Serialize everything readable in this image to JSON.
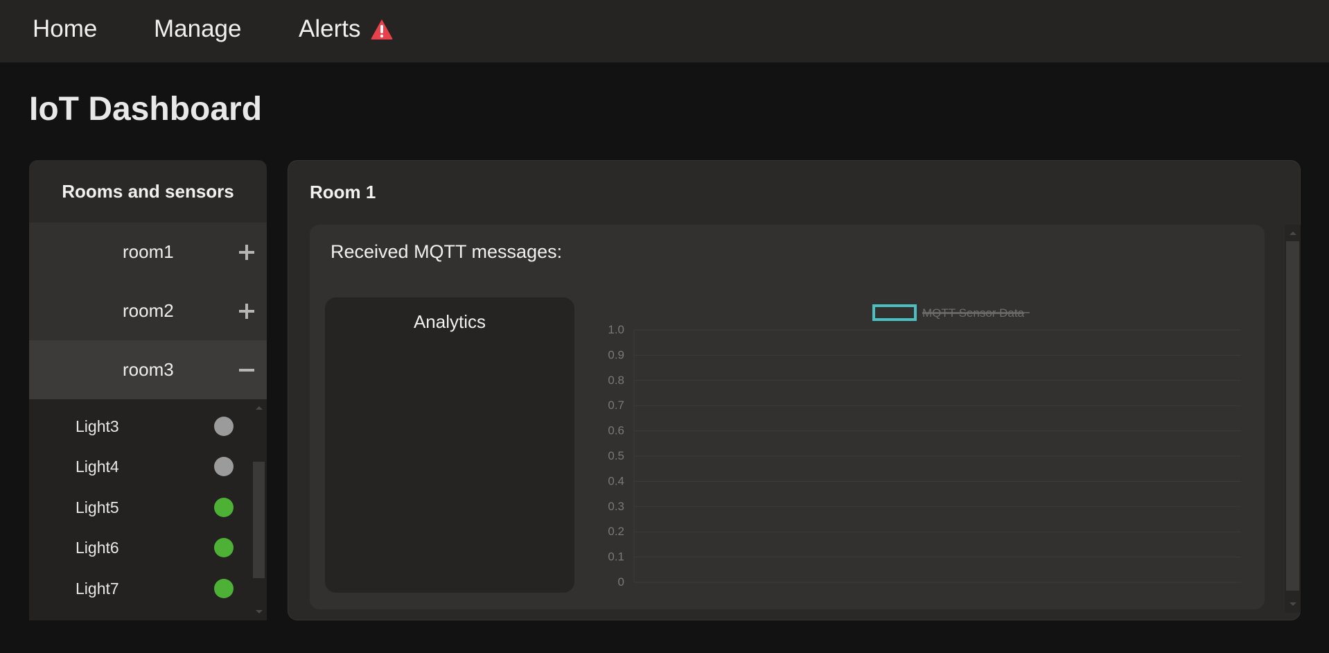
{
  "nav": {
    "home": "Home",
    "manage": "Manage",
    "alerts": "Alerts",
    "alert_icon": "warning-triangle-icon"
  },
  "page": {
    "title": "IoT Dashboard"
  },
  "sidebar": {
    "header": "Rooms and sensors",
    "rooms": [
      {
        "label": "room1",
        "state": "collapsed"
      },
      {
        "label": "room2",
        "state": "collapsed"
      },
      {
        "label": "room3",
        "state": "expanded"
      }
    ],
    "sensors": [
      {
        "label": "Light3",
        "status_color": "#9b9b9b"
      },
      {
        "label": "Light4",
        "status_color": "#9b9b9b"
      },
      {
        "label": "Light5",
        "status_color": "#4db135"
      },
      {
        "label": "Light6",
        "status_color": "#4db135"
      },
      {
        "label": "Light7",
        "status_color": "#4db135"
      }
    ]
  },
  "main": {
    "panel_title": "Room 1",
    "messages_heading": "Received MQTT messages:",
    "analytics_title": "Analytics"
  },
  "chart_data": {
    "type": "line",
    "series": [
      {
        "name": "MQTT Sensor Data",
        "values": []
      }
    ],
    "legend_hidden": true,
    "ylim": [
      0,
      1.0
    ],
    "yticks": [
      "1.0",
      "0.9",
      "0.8",
      "0.7",
      "0.6",
      "0.5",
      "0.4",
      "0.3",
      "0.2",
      "0.1",
      "0"
    ],
    "legend_placement": "top-center",
    "grid": true,
    "series_color": "#4bc0c0"
  },
  "colors": {
    "accent_alert": "#e8414b",
    "status_on": "#4db135",
    "status_off": "#9b9b9b"
  }
}
